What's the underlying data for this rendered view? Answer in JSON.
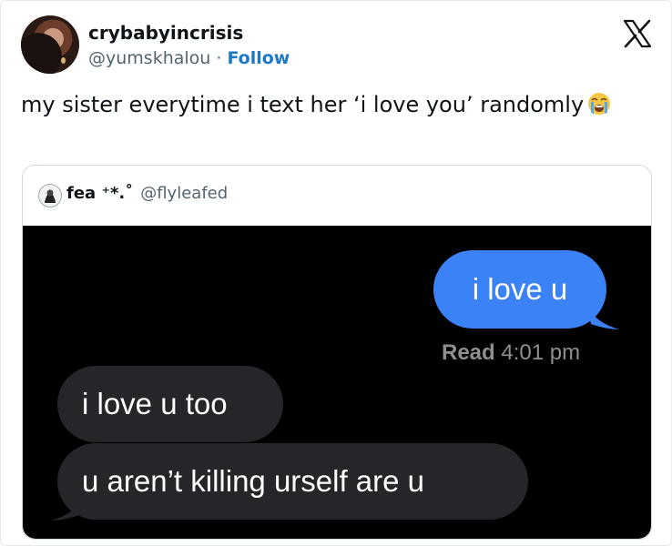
{
  "tweet": {
    "author_name": "crybabyincrisis",
    "author_handle": "@yumskhalou",
    "separator": " · ",
    "follow_label": "Follow",
    "text": "my sister everytime i text her ‘i love you’ randomly",
    "emoji": "loudly-crying-face"
  },
  "quoted_tweet": {
    "author_name": "fea ⁺*.˚",
    "author_handle": "@flyleafed"
  },
  "chat": {
    "sent_message": "i love u",
    "read_label": "Read",
    "read_time": "4:01 pm",
    "received_messages": [
      "i love u too",
      "u aren’t killing urself are u"
    ]
  },
  "colors": {
    "sent_bubble": "#3b82f6",
    "received_bubble": "#26252a",
    "chat_background": "#000000",
    "follow_link": "#1d78c8"
  }
}
